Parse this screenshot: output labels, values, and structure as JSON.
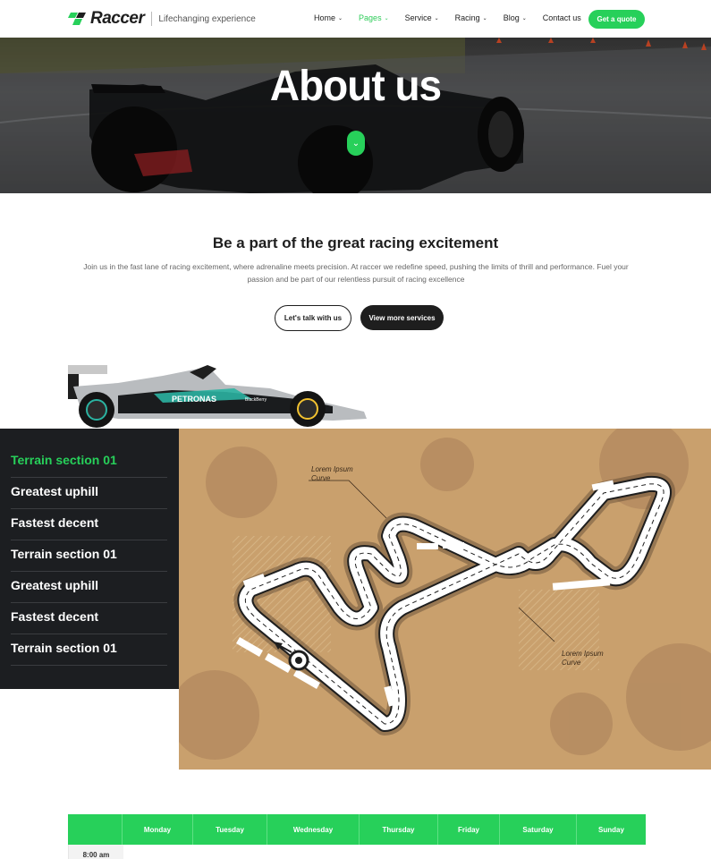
{
  "brand": {
    "name": "Raccer",
    "tagline": "Lifechanging experience",
    "accent": "#27d05a",
    "dark": "#1c1e21"
  },
  "nav": {
    "items": [
      {
        "label": "Home",
        "dropdown": true,
        "active": false
      },
      {
        "label": "Pages",
        "dropdown": true,
        "active": true
      },
      {
        "label": "Service",
        "dropdown": true,
        "active": false
      },
      {
        "label": "Racing",
        "dropdown": true,
        "active": false
      },
      {
        "label": "Blog",
        "dropdown": true,
        "active": false
      },
      {
        "label": "Contact us",
        "dropdown": false,
        "active": false
      }
    ],
    "cta": "Get a quote"
  },
  "hero": {
    "title": "About us",
    "scroll_icon": "chevron-down-icon"
  },
  "intro": {
    "title": "Be a part of the great racing excitement",
    "text": "Join us in the fast lane of racing excitement, where adrenaline meets precision. At raccer we redefine speed, pushing the limits of thrill and performance. Fuel your passion and be part of our relentless pursuit of racing excellence",
    "btn_talk": "Let's talk with us",
    "btn_services": "View more services"
  },
  "car": {
    "livery_text": "PETRONAS",
    "sponsor": "BlackBerry"
  },
  "terrain": {
    "items": [
      {
        "label": "Terrain section 01",
        "active": true
      },
      {
        "label": "Greatest uphill",
        "active": false
      },
      {
        "label": "Fastest decent",
        "active": false
      },
      {
        "label": "Terrain section 01",
        "active": false
      },
      {
        "label": "Greatest uphill",
        "active": false
      },
      {
        "label": "Fastest decent",
        "active": false
      },
      {
        "label": "Terrain section 01",
        "active": false
      }
    ]
  },
  "map": {
    "label_top": "Lorem Ipsum\nCurve",
    "label_bottom": "Lorem Ipsum\nCurve"
  },
  "schedule": {
    "days": [
      "Monday",
      "Tuesday",
      "Wednesday",
      "Thursday",
      "Friday",
      "Saturday",
      "Sunday"
    ],
    "first_time": "8:00 am"
  }
}
